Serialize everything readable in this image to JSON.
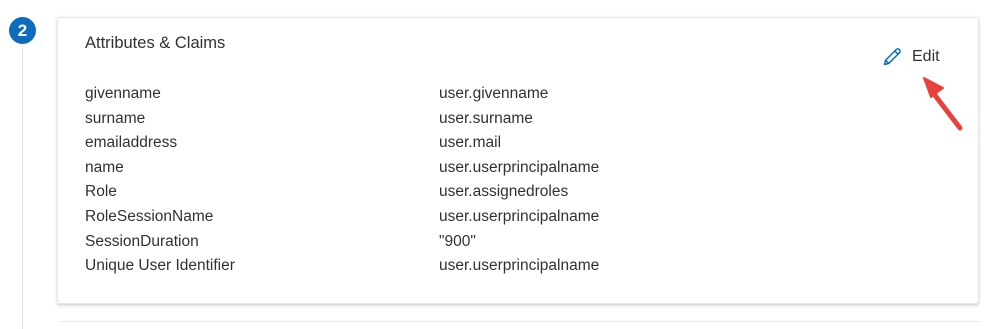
{
  "step": {
    "number": "2"
  },
  "section": {
    "title": "Attributes & Claims",
    "edit_label": "Edit"
  },
  "claims": [
    {
      "name": "givenname",
      "value": "user.givenname"
    },
    {
      "name": "surname",
      "value": "user.surname"
    },
    {
      "name": "emailaddress",
      "value": "user.mail"
    },
    {
      "name": "name",
      "value": "user.userprincipalname"
    },
    {
      "name": "Role",
      "value": "user.assignedroles"
    },
    {
      "name": "RoleSessionName",
      "value": "user.userprincipalname"
    },
    {
      "name": "SessionDuration",
      "value": "\"900\""
    },
    {
      "name": "Unique User Identifier",
      "value": "user.userprincipalname"
    }
  ],
  "icons": {
    "edit": "pencil-icon",
    "annotation": "red-arrow"
  },
  "colors": {
    "step_badge": "#0f6cbd",
    "edit_icon": "#0f6cbd",
    "annotation_arrow": "#e8413c",
    "text": "#323130"
  }
}
